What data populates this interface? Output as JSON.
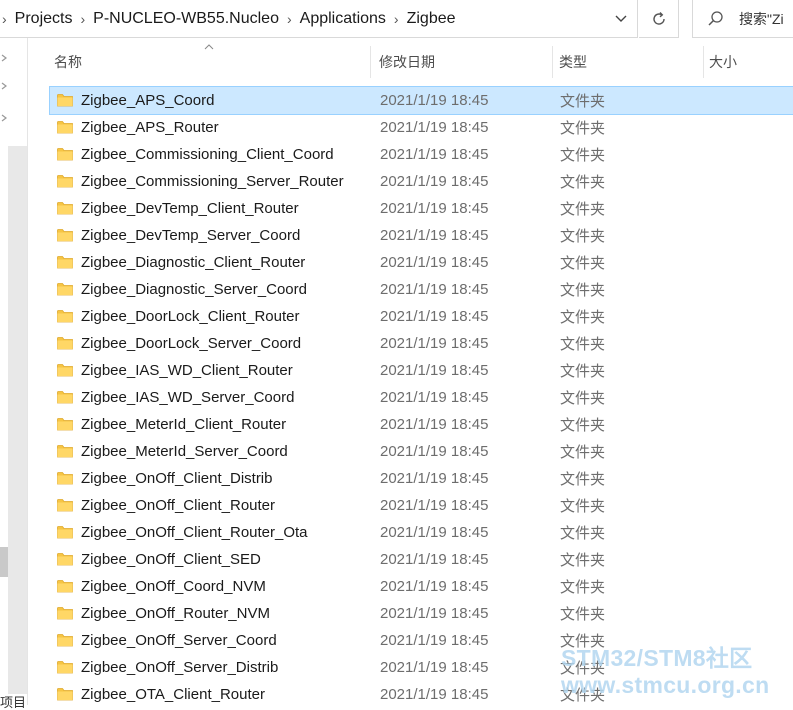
{
  "address_bar": {
    "crumbs": [
      "Projects",
      "P-NUCLEO-WB55.Nucleo",
      "Applications",
      "Zigbee"
    ]
  },
  "search": {
    "placeholder": "搜索\"Zi"
  },
  "columns": {
    "name": "名称",
    "date": "修改日期",
    "type": "类型",
    "size": "大小"
  },
  "files": [
    {
      "name": "Zigbee_APS_Coord",
      "date": "2021/1/19 18:45",
      "type": "文件夹",
      "selected": true
    },
    {
      "name": "Zigbee_APS_Router",
      "date": "2021/1/19 18:45",
      "type": "文件夹"
    },
    {
      "name": "Zigbee_Commissioning_Client_Coord",
      "date": "2021/1/19 18:45",
      "type": "文件夹"
    },
    {
      "name": "Zigbee_Commissioning_Server_Router",
      "date": "2021/1/19 18:45",
      "type": "文件夹"
    },
    {
      "name": "Zigbee_DevTemp_Client_Router",
      "date": "2021/1/19 18:45",
      "type": "文件夹"
    },
    {
      "name": "Zigbee_DevTemp_Server_Coord",
      "date": "2021/1/19 18:45",
      "type": "文件夹"
    },
    {
      "name": "Zigbee_Diagnostic_Client_Router",
      "date": "2021/1/19 18:45",
      "type": "文件夹"
    },
    {
      "name": "Zigbee_Diagnostic_Server_Coord",
      "date": "2021/1/19 18:45",
      "type": "文件夹"
    },
    {
      "name": "Zigbee_DoorLock_Client_Router",
      "date": "2021/1/19 18:45",
      "type": "文件夹"
    },
    {
      "name": "Zigbee_DoorLock_Server_Coord",
      "date": "2021/1/19 18:45",
      "type": "文件夹"
    },
    {
      "name": "Zigbee_IAS_WD_Client_Router",
      "date": "2021/1/19 18:45",
      "type": "文件夹"
    },
    {
      "name": "Zigbee_IAS_WD_Server_Coord",
      "date": "2021/1/19 18:45",
      "type": "文件夹"
    },
    {
      "name": "Zigbee_MeterId_Client_Router",
      "date": "2021/1/19 18:45",
      "type": "文件夹"
    },
    {
      "name": "Zigbee_MeterId_Server_Coord",
      "date": "2021/1/19 18:45",
      "type": "文件夹"
    },
    {
      "name": "Zigbee_OnOff_Client_Distrib",
      "date": "2021/1/19 18:45",
      "type": "文件夹"
    },
    {
      "name": "Zigbee_OnOff_Client_Router",
      "date": "2021/1/19 18:45",
      "type": "文件夹"
    },
    {
      "name": "Zigbee_OnOff_Client_Router_Ota",
      "date": "2021/1/19 18:45",
      "type": "文件夹"
    },
    {
      "name": "Zigbee_OnOff_Client_SED",
      "date": "2021/1/19 18:45",
      "type": "文件夹"
    },
    {
      "name": "Zigbee_OnOff_Coord_NVM",
      "date": "2021/1/19 18:45",
      "type": "文件夹"
    },
    {
      "name": "Zigbee_OnOff_Router_NVM",
      "date": "2021/1/19 18:45",
      "type": "文件夹"
    },
    {
      "name": "Zigbee_OnOff_Server_Coord",
      "date": "2021/1/19 18:45",
      "type": "文件夹"
    },
    {
      "name": "Zigbee_OnOff_Server_Distrib",
      "date": "2021/1/19 18:45",
      "type": "文件夹"
    },
    {
      "name": "Zigbee_OTA_Client_Router",
      "date": "2021/1/19 18:45",
      "type": "文件夹"
    }
  ],
  "bottom_status": "项目",
  "watermark": {
    "line1": "STM32/STM8社区",
    "line2": "www.stmcu.org.cn"
  },
  "colors": {
    "folder": "#f6c544",
    "selection": "#cce8ff"
  }
}
